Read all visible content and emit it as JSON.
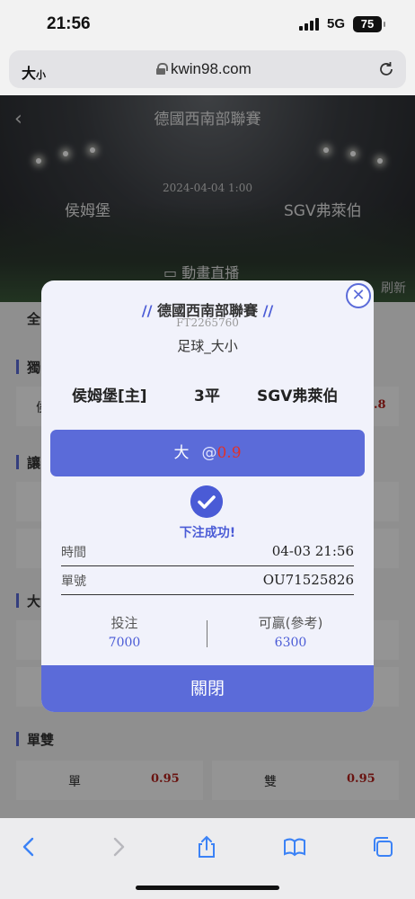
{
  "status": {
    "time": "21:56",
    "network": "5G",
    "battery": "75"
  },
  "browser": {
    "text_size_label": "大",
    "text_size_small": "小",
    "url": "kwin98.com"
  },
  "match": {
    "league": "德國西南部聯賽",
    "datetime": "2024-04-04 1:00",
    "home": "侯姆堡",
    "away": "SGV弗萊伯",
    "live_label": "動畫直播",
    "refresh_label": "刷新"
  },
  "page": {
    "tab_all": "全",
    "sections": [
      "獨",
      "讓",
      "大",
      "單雙"
    ],
    "odd_even": [
      {
        "name": "單",
        "odds": "0.95"
      },
      {
        "name": "雙",
        "odds": "0.95"
      }
    ],
    "partial_odds": ".8",
    "partial_name": "侯"
  },
  "bet_slip": {
    "slash_left": "//",
    "league": "德國西南部聯賽",
    "slash_right": "//",
    "code": "FT2265760",
    "bet_type": "足球_大小",
    "home": "侯姆堡[主]",
    "handicap": "3平",
    "away": "SGV弗萊伯",
    "pick": "大",
    "at": "@",
    "odds": "0.9",
    "success": "下注成功!",
    "time_label": "時間",
    "time_value": "04-03 21:56",
    "ticket_label": "單號",
    "ticket_value": "OU71525826",
    "stake_label": "投注",
    "stake_value": "7000",
    "payout_label": "可贏(參考)",
    "payout_value": "6300",
    "close_label": "關閉"
  },
  "colors": {
    "accent": "#5b6bd9",
    "odds_red": "#e0312a",
    "text": "#222222"
  }
}
